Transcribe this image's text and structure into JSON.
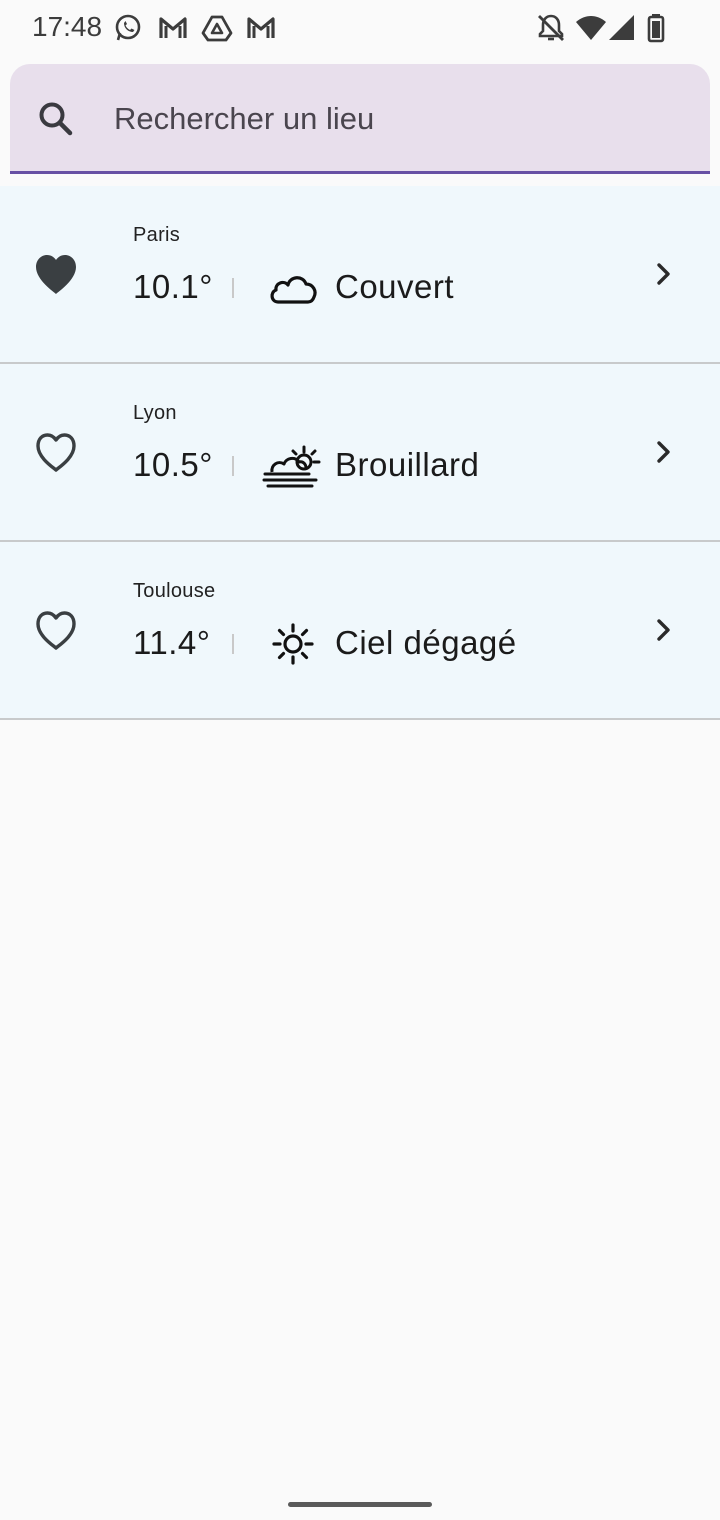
{
  "status_bar": {
    "time": "17:48",
    "left_icons": [
      "whatsapp-icon",
      "gmail-icon",
      "drive-icon",
      "gmail-icon"
    ],
    "right_icons": [
      "notifications-off-icon",
      "wifi-icon",
      "signal-icon",
      "battery-icon"
    ]
  },
  "search": {
    "placeholder": "Rechercher un lieu",
    "icon": "search-icon"
  },
  "cities": [
    {
      "name": "Paris",
      "temperature": "10.1°",
      "condition": "Couvert",
      "condition_icon": "cloud-icon",
      "favorite": true
    },
    {
      "name": "Lyon",
      "temperature": "10.5°",
      "condition": "Brouillard",
      "condition_icon": "fog-icon",
      "favorite": false
    },
    {
      "name": "Toulouse",
      "temperature": "11.4°",
      "condition": "Ciel dégagé",
      "condition_icon": "sun-icon",
      "favorite": false
    }
  ],
  "colors": {
    "search_background": "#e8dfec",
    "search_underline": "#6750a4",
    "list_item_background": "#f0f8fc",
    "icon_color": "#3a3f42"
  }
}
